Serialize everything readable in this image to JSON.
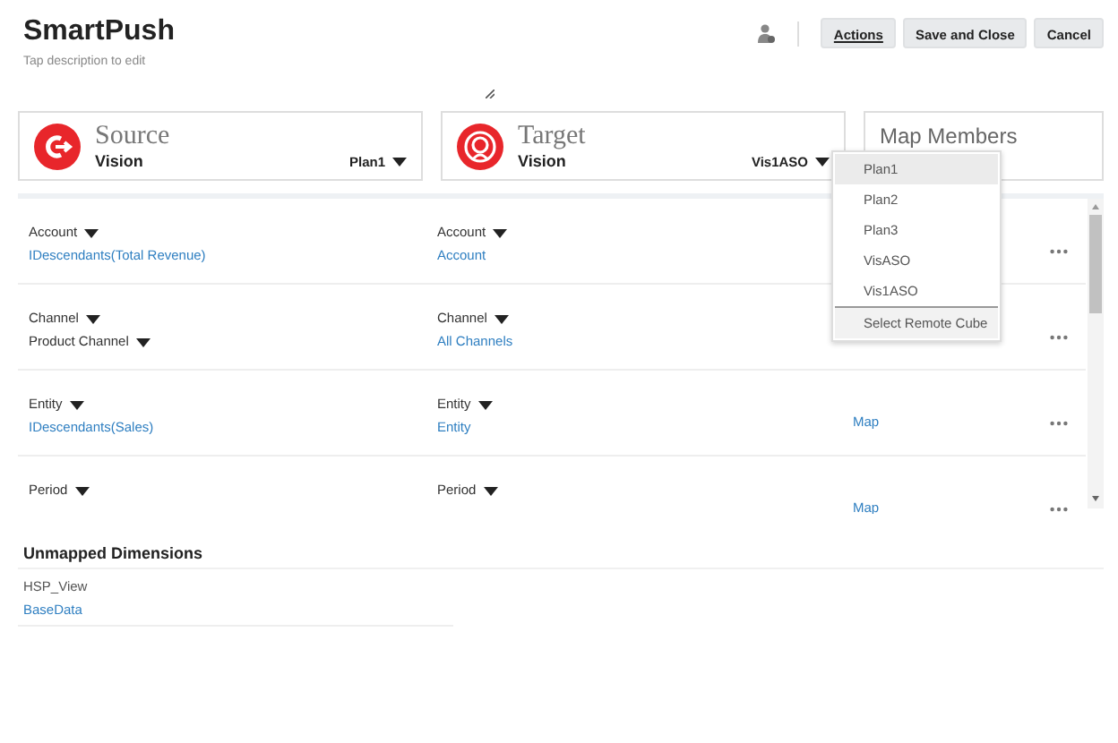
{
  "header": {
    "title": "SmartPush",
    "description_placeholder": "Tap description to edit",
    "buttons": [
      {
        "label": "Actions",
        "kind": "menu"
      },
      {
        "label": "Save and Close",
        "kind": "plain"
      },
      {
        "label": "Cancel",
        "kind": "plain"
      }
    ]
  },
  "cards": [
    {
      "kind": "source",
      "heading": "Source",
      "app": "Vision",
      "cube": "Plan1"
    },
    {
      "kind": "target",
      "heading": "Target",
      "app": "Vision",
      "cube": "Vis1ASO"
    },
    {
      "kind": "map",
      "heading": "Map Members"
    }
  ],
  "mappings": [
    {
      "source_dimension": "Account",
      "source_value": "IDescendants(Total Revenue)",
      "kind": "link",
      "target_dimension": "Account",
      "target_value": "Account"
    },
    {
      "source_dimension": "Channel",
      "source_value": "Product Channel",
      "kind": "dropdown",
      "target_dimension": "Channel",
      "target_value": "All Channels"
    },
    {
      "source_dimension": "Entity",
      "source_value": "IDescendants(Sales)",
      "kind": "link",
      "target_dimension": "Entity",
      "target_value": "Entity",
      "map_link": "Map"
    },
    {
      "source_dimension": "Period",
      "target_dimension": "Period",
      "map_link": "Map"
    }
  ],
  "cube_menu": [
    {
      "label": "Plan1",
      "selected": true,
      "kind": "option"
    },
    {
      "label": "Plan2",
      "selected": false,
      "kind": "option"
    },
    {
      "label": "Plan3",
      "selected": false,
      "kind": "option"
    },
    {
      "label": "VisASO",
      "selected": false,
      "kind": "option"
    },
    {
      "label": "Vis1ASO",
      "selected": false,
      "kind": "option"
    },
    {
      "label": "Select Remote Cube",
      "selected": false,
      "kind": "action"
    }
  ],
  "unmapped": {
    "title": "Unmapped Dimensions",
    "items": [
      {
        "name": "HSP_View",
        "value": "BaseData"
      }
    ]
  }
}
